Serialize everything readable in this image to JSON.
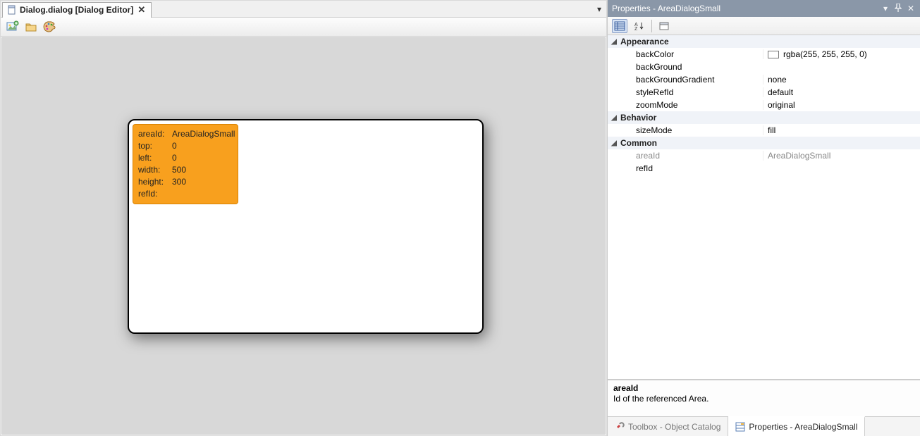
{
  "editor": {
    "tab_title": "Dialog.dialog [Dialog Editor]",
    "area_info": {
      "areaId_label": "areaId:",
      "areaId_value": "AreaDialogSmall",
      "top_label": "top:",
      "top_value": "0",
      "left_label": "left:",
      "left_value": "0",
      "width_label": "width:",
      "width_value": "500",
      "height_label": "height:",
      "height_value": "300",
      "refId_label": "refId:",
      "refId_value": ""
    }
  },
  "properties": {
    "panel_title": "Properties - AreaDialogSmall",
    "categories": [
      {
        "name": "Appearance",
        "props": [
          {
            "name": "backColor",
            "value": "rgba(255, 255, 255, 0)",
            "swatch": true
          },
          {
            "name": "backGround",
            "value": ""
          },
          {
            "name": "backGroundGradient",
            "value": "none"
          },
          {
            "name": "styleRefId",
            "value": "default"
          },
          {
            "name": "zoomMode",
            "value": "original"
          }
        ]
      },
      {
        "name": "Behavior",
        "props": [
          {
            "name": "sizeMode",
            "value": "fill"
          }
        ]
      },
      {
        "name": "Common",
        "props": [
          {
            "name": "areaId",
            "value": "AreaDialogSmall",
            "readonly": true
          },
          {
            "name": "refId",
            "value": ""
          }
        ]
      }
    ],
    "description": {
      "name": "areaId",
      "text": "Id of the referenced Area."
    }
  },
  "bottom_tabs": {
    "toolbox": "Toolbox - Object Catalog",
    "properties": "Properties - AreaDialogSmall"
  }
}
